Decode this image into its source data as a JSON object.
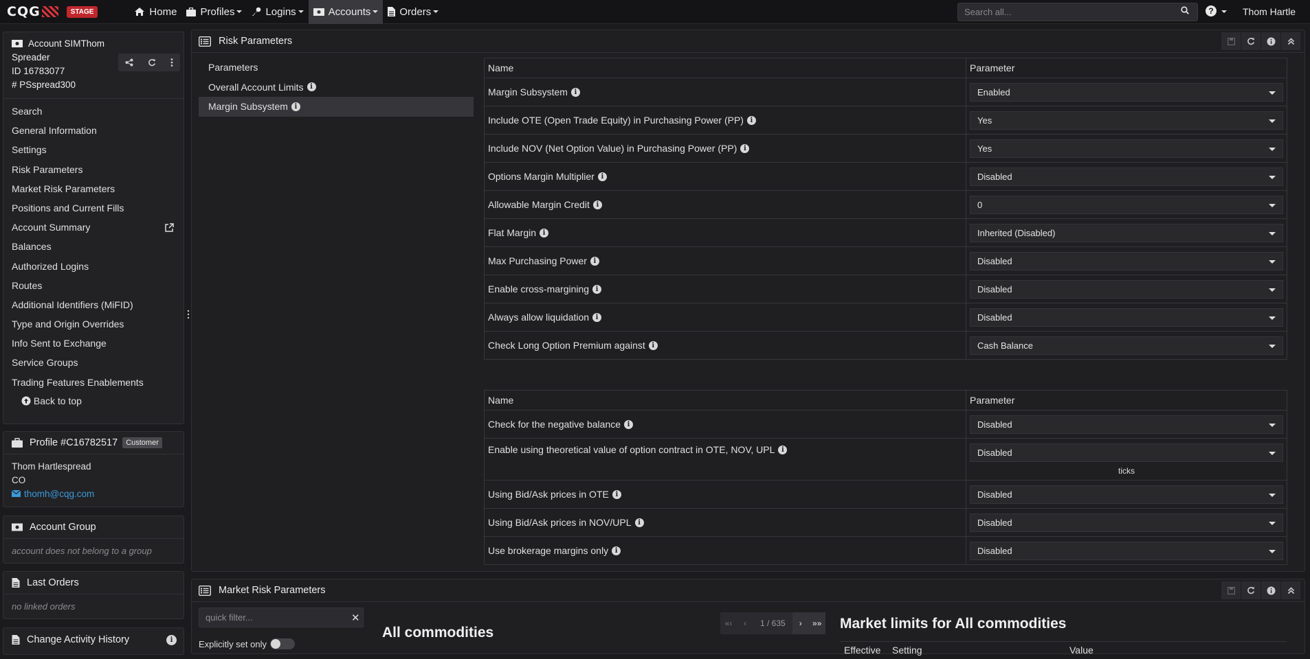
{
  "navbar": {
    "logo": "CQG",
    "stage_badge": "STAGE",
    "items": [
      {
        "label": "Home",
        "icon": "home-icon"
      },
      {
        "label": "Profiles",
        "icon": "briefcase-icon"
      },
      {
        "label": "Logins",
        "icon": "key-icon"
      },
      {
        "label": "Accounts",
        "icon": "money-icon"
      },
      {
        "label": "Orders",
        "icon": "document-icon"
      }
    ],
    "search_placeholder": "Search all...",
    "help": "?",
    "user": "Thom Hartle"
  },
  "account": {
    "title": "Account SIMThom Spreader",
    "title_line1": "Account SIMThom",
    "title_line2": "Spreader",
    "id": "ID 16783077",
    "number": "# PSspread300",
    "nav": [
      "Search",
      "General Information",
      "Settings",
      "Risk Parameters",
      "Market Risk Parameters",
      "Positions and Current Fills",
      "Account Summary",
      "Balances",
      "Authorized Logins",
      "Routes",
      "Additional Identifiers (MiFID)",
      "Type and Origin Overrides",
      "Info Sent to Exchange",
      "Service Groups",
      "Trading Features Enablements"
    ],
    "back_to_top": "Back to top"
  },
  "profile": {
    "title": "Profile #C16782517",
    "badge": "Customer",
    "name": "Thom Hartlespread",
    "state": "CO",
    "email": "thomh@cqg.com"
  },
  "account_group": {
    "title": "Account Group",
    "empty": "account does not belong to a group"
  },
  "last_orders": {
    "title": "Last Orders",
    "empty": "no linked orders"
  },
  "change_history": {
    "title": "Change Activity History"
  },
  "risk": {
    "title": "Risk Parameters",
    "subnav": [
      "Parameters",
      "Overall Account Limits",
      "Margin Subsystem"
    ],
    "table1_headers": [
      "Name",
      "Parameter"
    ],
    "table1": [
      {
        "name": "Margin Subsystem",
        "value": "Enabled"
      },
      {
        "name": "Include OTE (Open Trade Equity) in Purchasing Power (PP)",
        "value": "Yes"
      },
      {
        "name": "Include NOV (Net Option Value) in Purchasing Power (PP)",
        "value": "Yes"
      },
      {
        "name": "Options Margin Multiplier",
        "value": "Disabled"
      },
      {
        "name": "Allowable Margin Credit",
        "value": "0"
      },
      {
        "name": "Flat Margin",
        "value": "Inherited (Disabled)"
      },
      {
        "name": "Max Purchasing Power",
        "value": "Disabled"
      },
      {
        "name": "Enable cross-margining",
        "value": "Disabled"
      },
      {
        "name": "Always allow liquidation",
        "value": "Disabled"
      },
      {
        "name": "Check Long Option Premium against",
        "value": "Cash Balance"
      }
    ],
    "table2_headers": [
      "Name",
      "Parameter"
    ],
    "table2": [
      {
        "name": "Check for the negative balance",
        "value": "Disabled"
      },
      {
        "name": "Enable using theoretical value of option contract in OTE, NOV, UPL",
        "value": "Disabled",
        "extra": "ticks"
      },
      {
        "name": "Using Bid/Ask prices in OTE",
        "value": "Disabled"
      },
      {
        "name": "Using Bid/Ask prices in NOV/UPL",
        "value": "Disabled"
      },
      {
        "name": "Use brokerage margins only",
        "value": "Disabled"
      }
    ]
  },
  "market_risk": {
    "title": "Market Risk Parameters",
    "filter_placeholder": "quick filter...",
    "explicit_label": "Explicitly set only",
    "all_commodities": "All commodities",
    "pager": {
      "first": "«‹",
      "prev": "‹",
      "page": "1 / 635",
      "next": "›",
      "last": "»»"
    },
    "limits_title": "Market limits for All commodities",
    "columns": [
      "Effective",
      "Setting",
      "Value"
    ]
  }
}
